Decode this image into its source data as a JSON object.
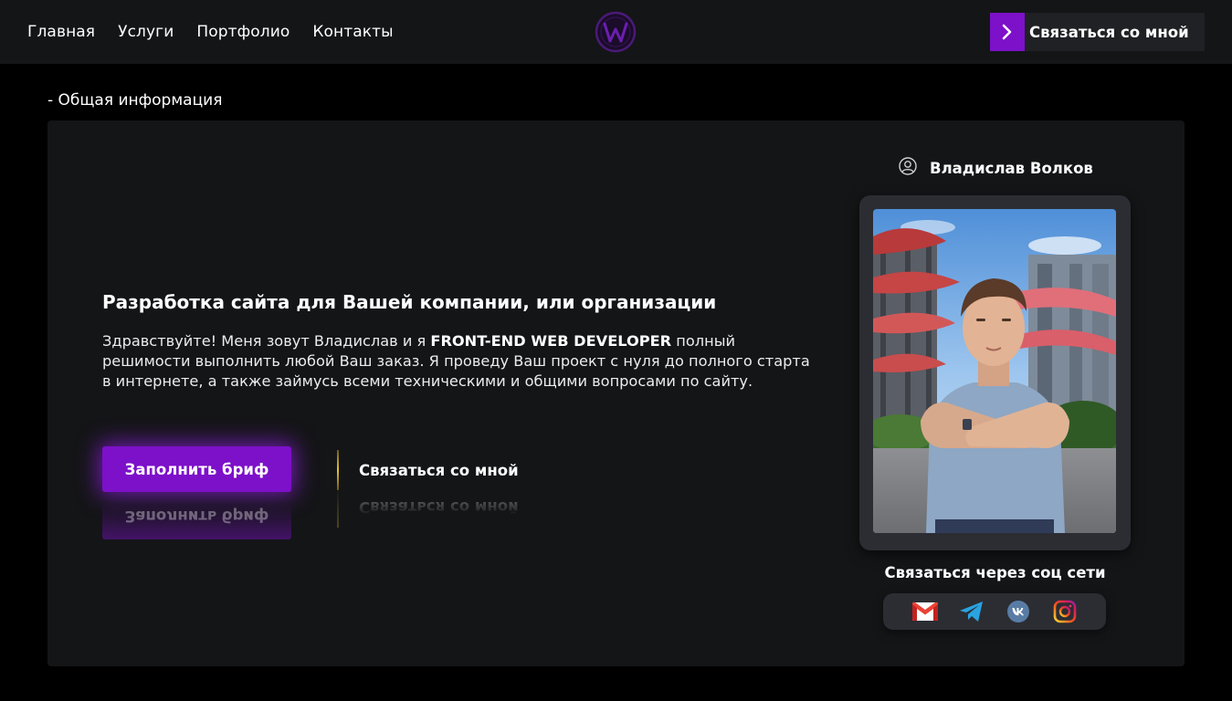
{
  "header": {
    "nav": [
      {
        "label": "Главная"
      },
      {
        "label": "Услуги"
      },
      {
        "label": "Портфолио"
      },
      {
        "label": "Контакты"
      }
    ],
    "logo_icon": "w-logo-icon",
    "cta_label": "Связаться со мной",
    "cta_icon": "chevron-right-icon"
  },
  "section_label": "- Общая информация",
  "hero": {
    "headline": "Разработка сайта для Вашей компании, или организации",
    "intro_before": "Здравствуйте! Меня зовут Владислав и я ",
    "intro_bold": "FRONT-END WEB DEVELOPER",
    "intro_after": " полный решимости выполнить любой Ваш заказ. Я проведу Ваш проект с нуля до полного старта в интернете, а также займусь всеми техническими и общими вопросами по сайту.",
    "primary_button": "Заполнить бриф",
    "secondary_button": "Связаться со мной"
  },
  "profile": {
    "name": "Владислав Волков",
    "user_icon": "user-circle-icon",
    "social_title": "Связаться через соц сети",
    "social": [
      {
        "icon": "gmail-icon"
      },
      {
        "icon": "telegram-icon"
      },
      {
        "icon": "vk-icon"
      },
      {
        "icon": "instagram-icon"
      }
    ]
  },
  "colors": {
    "accent": "#7d10c9",
    "background": "#000000",
    "panel": "#141517",
    "frame": "#2b2d33",
    "gold": "#e6c23a"
  }
}
